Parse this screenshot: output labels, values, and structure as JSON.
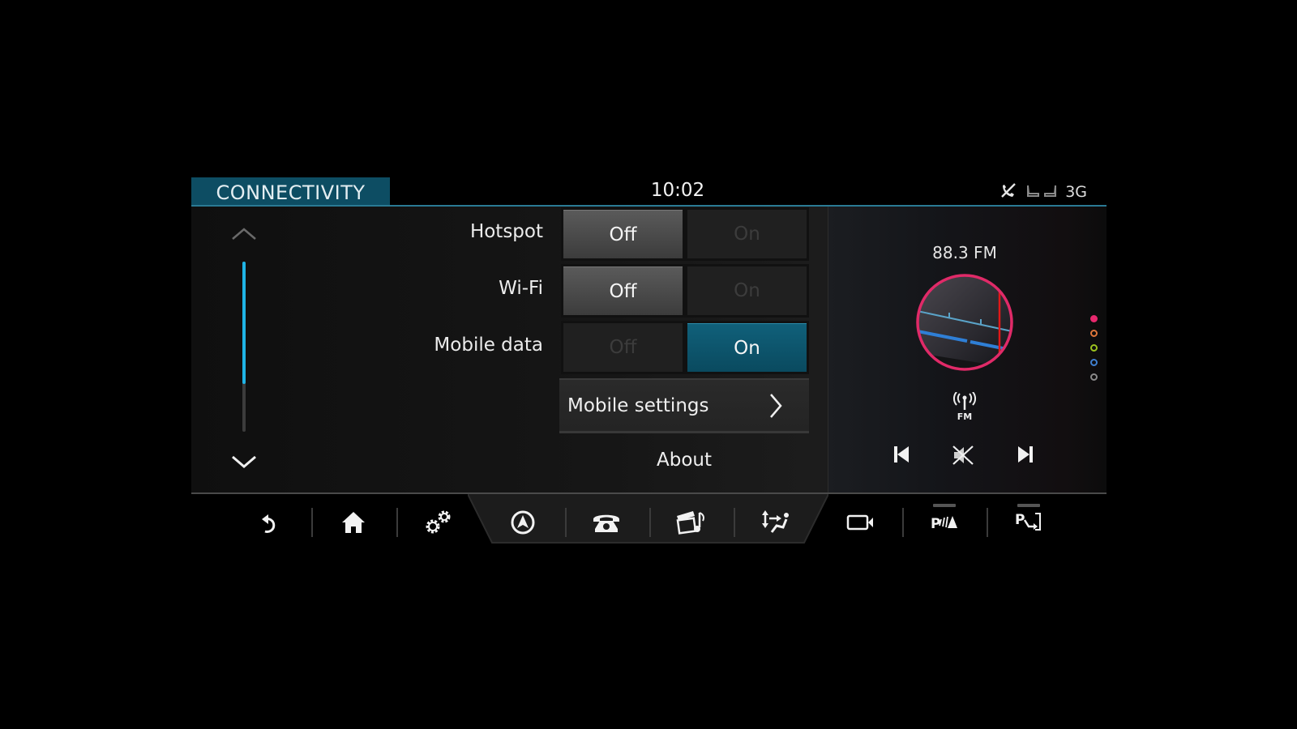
{
  "header": {
    "title": "CONNECTIVITY",
    "time": "10:02",
    "status": {
      "icons": [
        "phone-disconnected-icon",
        "seat-left-icon",
        "seat-right-icon"
      ],
      "network": "3G"
    }
  },
  "scroll": {
    "position_fraction": 0.72,
    "up_icon": "chevron-up-icon",
    "down_icon": "chevron-down-icon"
  },
  "settings": [
    {
      "label": "Hotspot",
      "off_label": "Off",
      "on_label": "On",
      "value": "Off"
    },
    {
      "label": "Wi-Fi",
      "off_label": "Off",
      "on_label": "On",
      "value": "Off"
    },
    {
      "label": "Mobile data",
      "off_label": "Off",
      "on_label": "On",
      "value": "On"
    }
  ],
  "menu": {
    "mobile_settings": "Mobile settings",
    "about": "About"
  },
  "media": {
    "station": "88.3 FM",
    "source_label": "FM",
    "source_icon": "radio-antenna-icon",
    "controls": [
      "previous-track-icon",
      "mute-icon",
      "next-track-icon"
    ],
    "page_dots": [
      {
        "color": "#e8286e",
        "active": true
      },
      {
        "color": "#e0763a",
        "active": false
      },
      {
        "color": "#9cc21f",
        "active": false
      },
      {
        "color": "#3f7fd0",
        "active": false
      },
      {
        "color": "#8a8a8a",
        "active": false
      }
    ]
  },
  "bottom_bar": {
    "items": [
      {
        "name": "back",
        "icon": "back-icon"
      },
      {
        "name": "home",
        "icon": "home-icon"
      },
      {
        "name": "settings",
        "icon": "gears-icon"
      },
      {
        "name": "navigation",
        "icon": "navigation-icon"
      },
      {
        "name": "phone",
        "icon": "phone-icon"
      },
      {
        "name": "media",
        "icon": "media-icon"
      },
      {
        "name": "climate",
        "icon": "climate-airflow-icon"
      },
      {
        "name": "camera",
        "icon": "camera-icon"
      },
      {
        "name": "park-distance",
        "icon": "parking-sensors-icon"
      },
      {
        "name": "park-assist",
        "icon": "park-assist-icon"
      }
    ]
  },
  "colors": {
    "accent": "#0d4d63",
    "accent_line": "#2a7a94",
    "toggle_on": "#10607a",
    "scroll_thumb": "#1fb4e6",
    "dial_ring": "#e02a68"
  }
}
